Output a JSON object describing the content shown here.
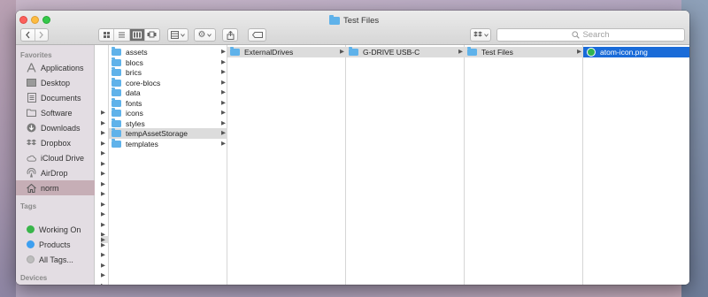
{
  "window": {
    "title": "Test Files"
  },
  "toolbar": {
    "back_icon": "chevron-left-icon",
    "forward_icon": "chevron-right-icon",
    "view_modes": [
      "icon-view",
      "list-view",
      "column-view",
      "cover-flow-view"
    ],
    "active_view": "column-view",
    "search_placeholder": "Search"
  },
  "sidebar": {
    "favorites_header": "Favorites",
    "favorites": [
      {
        "label": "Applications",
        "icon": "applications-icon"
      },
      {
        "label": "Desktop",
        "icon": "desktop-icon"
      },
      {
        "label": "Documents",
        "icon": "documents-icon"
      },
      {
        "label": "Software",
        "icon": "folder-icon"
      },
      {
        "label": "Downloads",
        "icon": "downloads-icon"
      },
      {
        "label": "Dropbox",
        "icon": "dropbox-icon"
      },
      {
        "label": "iCloud Drive",
        "icon": "cloud-icon"
      },
      {
        "label": "AirDrop",
        "icon": "airdrop-icon"
      },
      {
        "label": "norm",
        "icon": "home-icon",
        "selected": true
      }
    ],
    "tags_header": "Tags",
    "tags": [
      {
        "label": "Working On",
        "color": "#39b54a"
      },
      {
        "label": "Products",
        "color": "#3d9ff0"
      },
      {
        "label": "All Tags...",
        "color": "#bdbdbd"
      }
    ],
    "devices_header": "Devices"
  },
  "columns": {
    "col1": [
      {
        "name": "assets"
      },
      {
        "name": "blocs"
      },
      {
        "name": "brics"
      },
      {
        "name": "core-blocs"
      },
      {
        "name": "data"
      },
      {
        "name": "fonts"
      },
      {
        "name": "icons"
      },
      {
        "name": "styles"
      },
      {
        "name": "tempAssetStorage",
        "selected": true
      },
      {
        "name": "templates"
      }
    ],
    "col2": [
      {
        "name": "ExternalDrives",
        "selected": true
      }
    ],
    "col3": [
      {
        "name": "G-DRIVE USB-C",
        "selected": true
      }
    ],
    "col4": [
      {
        "name": "Test Files",
        "selected": true
      }
    ],
    "col5": [
      {
        "name": "atom-icon.png",
        "selected": true
      }
    ]
  },
  "colors": {
    "selection_blue": "#1a6bd8",
    "selection_gray": "#dcdcdc",
    "folder_blue": "#5fb2ea",
    "sidebar_bg": "#e3dde3"
  }
}
